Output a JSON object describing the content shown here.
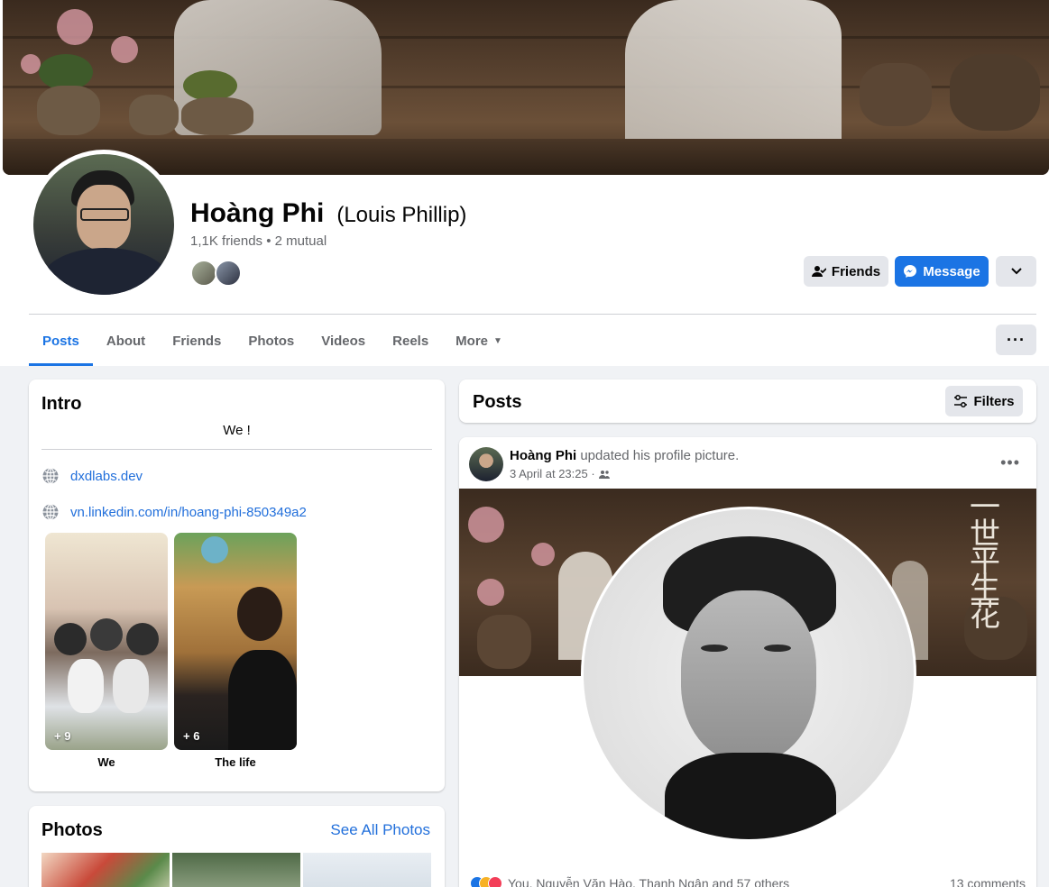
{
  "profile": {
    "name": "Hoàng Phi",
    "alternate_name": "(Louis Phillip)",
    "friends_summary": "1,1K friends • 2 mutual"
  },
  "actions": {
    "friends_label": "Friends",
    "message_label": "Message"
  },
  "tabs": [
    {
      "label": "Posts",
      "active": true
    },
    {
      "label": "About"
    },
    {
      "label": "Friends"
    },
    {
      "label": "Photos"
    },
    {
      "label": "Videos"
    },
    {
      "label": "Reels"
    },
    {
      "label": "More"
    }
  ],
  "intro": {
    "title": "Intro",
    "bio": "We !",
    "links": [
      "dxdlabs.dev",
      "vn.linkedin.com/in/hoang-phi-850349a2"
    ],
    "featured": [
      {
        "count": "+ 9",
        "label": "We"
      },
      {
        "count": "+ 6",
        "label": "The life"
      }
    ]
  },
  "photos": {
    "title": "Photos",
    "see_all": "See All Photos"
  },
  "posts_header": {
    "title": "Posts",
    "filters_label": "Filters"
  },
  "post": {
    "author": "Hoàng Phi",
    "action": "updated his profile picture.",
    "timestamp": "3 April at 23:25 ·",
    "reactions_text": "You, Nguyễn Văn Hào, Thanh Ngân and 57 others",
    "comments": "13 comments"
  },
  "colors": {
    "accent": "#1b74e4",
    "link": "#216fdb",
    "background": "#f0f2f5"
  }
}
